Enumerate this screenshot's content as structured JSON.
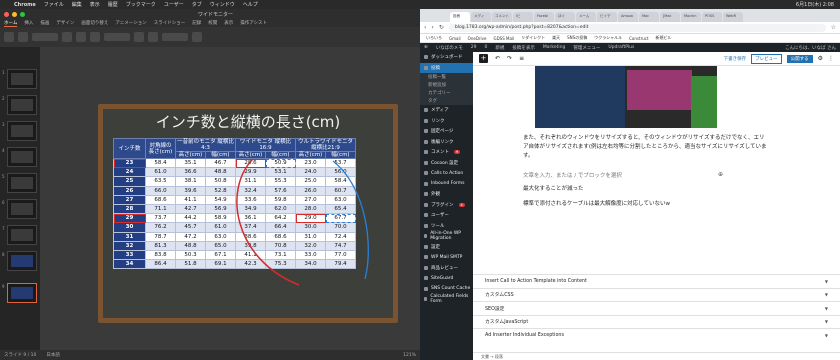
{
  "menubar": {
    "app": "Chrome",
    "items": [
      "ファイル",
      "編集",
      "表示",
      "履歴",
      "ブックマーク",
      "ユーザー",
      "タブ",
      "ウィンドウ",
      "ヘルプ"
    ],
    "clock": "6月1日(木) 2:08"
  },
  "keynote": {
    "filename": "ワイドモニター",
    "tabs": [
      "ホーム",
      "挿入",
      "描画",
      "デザイン",
      "画面切り替え",
      "アニメーション",
      "スライドショー",
      "記録",
      "校閲",
      "表示",
      "操作アシスト"
    ],
    "status_left": "スライド 9 / 10",
    "status_lang": "日本語",
    "zoom": "121%",
    "slide": {
      "title": "インチ数と縦横の長さ(cm)",
      "headers_top": [
        "インチ数",
        "対角線の長さ(cm)",
        "一昔前のモニタ 縦横比4:3",
        "ワイドモニタ 縦横比16:9",
        "ウルトラワイドモニタ 縦横比21:9"
      ],
      "headers_sub": [
        "高さ(cm)",
        "幅(cm)",
        "高さ(cm)",
        "幅(cm)",
        "高さ(cm)",
        "幅(cm)"
      ],
      "rows": [
        [
          "23",
          "58.4",
          "35.1",
          "46.7",
          "28.6",
          "50.9",
          "23.0",
          "53.7"
        ],
        [
          "24",
          "61.0",
          "36.6",
          "48.8",
          "29.9",
          "53.1",
          "24.0",
          "56.0"
        ],
        [
          "25",
          "63.5",
          "38.1",
          "50.8",
          "31.1",
          "55.3",
          "25.0",
          "58.4"
        ],
        [
          "26",
          "66.0",
          "39.6",
          "52.8",
          "32.4",
          "57.6",
          "26.0",
          "60.7"
        ],
        [
          "27",
          "68.6",
          "41.1",
          "54.9",
          "33.6",
          "59.8",
          "27.0",
          "63.0"
        ],
        [
          "28",
          "71.1",
          "42.7",
          "56.9",
          "34.9",
          "62.0",
          "28.0",
          "65.4"
        ],
        [
          "29",
          "73.7",
          "44.2",
          "58.9",
          "36.1",
          "64.2",
          "29.0",
          "67.7"
        ],
        [
          "30",
          "76.2",
          "45.7",
          "61.0",
          "37.4",
          "66.4",
          "30.0",
          "70.0"
        ],
        [
          "31",
          "78.7",
          "47.2",
          "63.0",
          "38.6",
          "68.6",
          "31.0",
          "72.4"
        ],
        [
          "32",
          "81.3",
          "48.8",
          "65.0",
          "39.8",
          "70.8",
          "32.0",
          "74.7"
        ],
        [
          "33",
          "83.8",
          "50.3",
          "67.1",
          "41.1",
          "73.1",
          "33.0",
          "77.0"
        ],
        [
          "34",
          "86.4",
          "51.8",
          "69.1",
          "42.3",
          "75.3",
          "34.0",
          "79.4"
        ]
      ]
    },
    "thumb_numbers": [
      "1",
      "2",
      "3",
      "4",
      "5",
      "6",
      "7",
      "8",
      "9"
    ]
  },
  "browser": {
    "tabs": [
      "投稿",
      "メディ",
      "コメント",
      "iビ",
      "Facebi",
      "ほぐ",
      "メーム",
      "ビイデ",
      "Amazo",
      "Mac",
      "[Mac",
      "Machin",
      "POSS",
      "WebR"
    ],
    "url": "blog.1783.org/wp-admin/post.php?post=8207&action=edit",
    "bookmarks": [
      "いろいろ",
      "Gmail",
      "OneDrive",
      "GDSS Mail",
      "リダイレクト",
      "楽天",
      "SNSの投稿",
      "ウクラシャルル",
      "Construct",
      "新規ビル"
    ]
  },
  "wp": {
    "adminbar": [
      "いなばのメモ",
      "29",
      "0",
      "新規",
      "投稿を表示",
      "Marketing",
      "管理メニュー",
      "UpdraftPlus"
    ],
    "adminbar_right": "こんにちは、いなば さん",
    "menu": [
      {
        "label": "ダッシュボード",
        "badge": "",
        "active": false,
        "sub": false
      },
      {
        "label": "投稿",
        "badge": "",
        "active": true,
        "sub": false
      },
      {
        "label": "投稿一覧",
        "badge": "",
        "active": false,
        "sub": true
      },
      {
        "label": "新規追加",
        "badge": "",
        "active": false,
        "sub": true
      },
      {
        "label": "カテゴリー",
        "badge": "",
        "active": false,
        "sub": true
      },
      {
        "label": "タグ",
        "badge": "",
        "active": false,
        "sub": true
      },
      {
        "label": "メディア",
        "badge": "",
        "active": false,
        "sub": false
      },
      {
        "label": "リンク",
        "badge": "",
        "active": false,
        "sub": false
      },
      {
        "label": "固定ページ",
        "badge": "",
        "active": false,
        "sub": false
      },
      {
        "label": "後編リンク",
        "badge": "",
        "active": false,
        "sub": false
      },
      {
        "label": "コメント",
        "badge": "9",
        "active": false,
        "sub": false
      },
      {
        "label": "Cocoon 設定",
        "badge": "",
        "active": false,
        "sub": false
      },
      {
        "label": "Calls to Action",
        "badge": "",
        "active": false,
        "sub": false
      },
      {
        "label": "Inbound Forms",
        "badge": "",
        "active": false,
        "sub": false
      },
      {
        "label": "外観",
        "badge": "",
        "active": false,
        "sub": false
      },
      {
        "label": "プラグイン",
        "badge": "4",
        "active": false,
        "sub": false
      },
      {
        "label": "ユーザー",
        "badge": "",
        "active": false,
        "sub": false
      },
      {
        "label": "ツール",
        "badge": "",
        "active": false,
        "sub": false
      },
      {
        "label": "All-in-One WP Migration",
        "badge": "",
        "active": false,
        "sub": false
      },
      {
        "label": "設定",
        "badge": "",
        "active": false,
        "sub": false
      },
      {
        "label": "WP Mail SMTP",
        "badge": "",
        "active": false,
        "sub": false
      },
      {
        "label": "商品レビュー",
        "badge": "",
        "active": false,
        "sub": false
      },
      {
        "label": "SiteGuard",
        "badge": "",
        "active": false,
        "sub": false
      },
      {
        "label": "SNS Count Cache",
        "badge": "",
        "active": false,
        "sub": false
      },
      {
        "label": "Calculated Fields Form",
        "badge": "",
        "active": false,
        "sub": false
      }
    ],
    "toolbar": {
      "draft": "下書き保存",
      "preview": "プレビュー",
      "publish": "公開する"
    },
    "content": {
      "para1": "また、それぞれのウィンドウをリサイズすると、そのウィンドウがリサイズするだけでなく、エリア自体がリサイズされます(例は左右均等に分割したところから、適当なサイズにリサイズしています。",
      "placeholder": "文章を入力、または / でブロックを選択",
      "para2": "最大化することが減った",
      "para3": "標準で添付されるケーブルは最大解像度に対応していないw"
    },
    "panels": [
      "Insert Call to Action Template into Content",
      "カスタムCSS",
      "SEO設定",
      "カスタムJavaScript",
      "Ad Inserter Individual Exceptions"
    ],
    "breadcrumb": "文書 → 段落"
  }
}
